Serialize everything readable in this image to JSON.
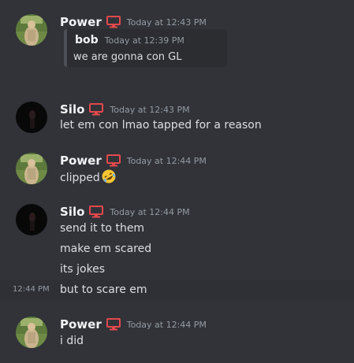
{
  "messages": [
    {
      "author": "Power",
      "timestamp": "Today at 12:43 PM",
      "tag_icon": "monitor-icon",
      "quote": {
        "author": "bob",
        "timestamp": "Today at 12:39 PM",
        "text": "we are gonna con GL"
      }
    },
    {
      "author": "Silo",
      "timestamp": "Today at 12:43 PM",
      "tag_icon": "monitor-icon",
      "lines": [
        "let em con lmao tapped for a reason"
      ]
    },
    {
      "author": "Power",
      "timestamp": "Today at 12:44 PM",
      "tag_icon": "monitor-icon",
      "lines": [
        "clipped"
      ],
      "emoji": "rolling-on-floor-laughing-emoji"
    },
    {
      "author": "Silo",
      "timestamp": "Today at 12:44 PM",
      "tag_icon": "monitor-icon",
      "lines": [
        "send it to them",
        "make em scared",
        "its jokes"
      ],
      "hovered_line": {
        "time": "12:44 PM",
        "text": "but to scare em"
      }
    },
    {
      "author": "Power",
      "timestamp": "Today at 12:44 PM",
      "tag_icon": "monitor-icon",
      "lines": [
        "i did"
      ]
    }
  ],
  "colors": {
    "background": "#313338",
    "tag_red": "#e5484d",
    "username": "#f2f3f5",
    "timestamp": "#949ba4",
    "text": "#dbdee1"
  }
}
